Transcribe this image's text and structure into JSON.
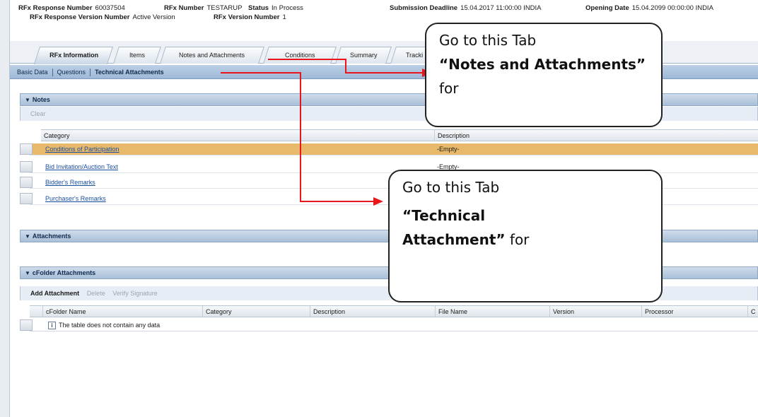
{
  "header": {
    "response_number_label": "RFx Response Number",
    "response_number": "60037504",
    "rfx_number_label": "RFx Number",
    "rfx_number": "TESTARUP",
    "status_label": "Status",
    "status": "In Process",
    "submission_deadline_label": "Submission Deadline",
    "submission_deadline": "15.04.2017 11:00:00 INDIA",
    "opening_date_label": "Opening Date",
    "opening_date": "15.04.2099 00:00:00 INDIA",
    "response_version_label": "RFx Response Version Number",
    "response_version": "Active Version",
    "rfx_version_label": "RFx Version Number",
    "rfx_version": "1"
  },
  "tabs": [
    {
      "label": "RFx Information",
      "active": true
    },
    {
      "label": "Items",
      "active": false
    },
    {
      "label": "Notes and Attachments",
      "active": false
    },
    {
      "label": "Conditions",
      "active": false
    },
    {
      "label": "Summary",
      "active": false
    },
    {
      "label": "Tracki",
      "active": false
    }
  ],
  "subnav": {
    "items": [
      "Basic Data",
      "Questions",
      "Technical Attachments"
    ]
  },
  "notes": {
    "title": "Notes",
    "toolbar": {
      "clear": "Clear"
    },
    "columns": [
      "Category",
      "Description"
    ],
    "rows": [
      {
        "category": "Conditions of Participation",
        "description": "-Empty-",
        "selected": true
      },
      {
        "category": "Bid Invitation/Auction Text",
        "description": "-Empty-",
        "selected": false
      },
      {
        "category": "Bidder's Remarks",
        "description": "",
        "selected": false
      },
      {
        "category": "Purchaser's Remarks",
        "description": "",
        "selected": false
      }
    ]
  },
  "attachments": {
    "title": "Attachments"
  },
  "cfolder": {
    "title": "cFolder Attachments",
    "toolbar": {
      "add": "Add Attachment",
      "delete": "Delete",
      "verify": "Verify Signature"
    },
    "columns": [
      "cFolder Name",
      "Category",
      "Description",
      "File Name",
      "Version",
      "Processor",
      "C"
    ],
    "empty_message": "The table does not contain any data"
  },
  "callouts": {
    "notes_tab": {
      "line1": "Go to this Tab",
      "bold": "“Notes and Attachments”",
      "tail": "for"
    },
    "tech_tab": {
      "line1": "Go to this Tab",
      "bold": "“Technical Attachment”",
      "tail": "for"
    }
  },
  "colors": {
    "arrow": "#e8161b",
    "selected_row": "#e8b96a",
    "link": "#1b4fa0"
  }
}
